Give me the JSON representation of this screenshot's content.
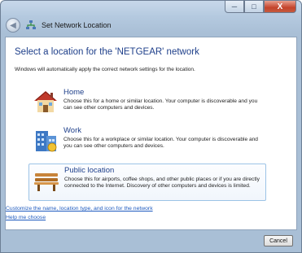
{
  "window": {
    "title": "Set Network Location",
    "minimize_glyph": "─",
    "maximize_glyph": "□",
    "close_glyph": "X",
    "back_glyph": "◀"
  },
  "main": {
    "heading": "Select a location for the 'NETGEAR' network",
    "subtext": "Windows will automatically apply the correct network settings for the location.",
    "options": [
      {
        "title": "Home",
        "description": "Choose this for a home or similar location. Your computer is discoverable and you can see other computers and devices.",
        "icon": "house-icon"
      },
      {
        "title": "Work",
        "description": "Choose this for a workplace or similar location. Your computer is discoverable and you can see other computers and devices.",
        "icon": "office-building-icon"
      },
      {
        "title": "Public location",
        "description": "Choose this for airports, coffee shops, and other public places or if you are directly connected to the Internet. Discovery of other computers and devices is limited.",
        "icon": "park-bench-icon"
      }
    ],
    "links": {
      "customize": "Customize the name, location type, and icon for the network",
      "help": "Help me choose"
    }
  },
  "footer": {
    "cancel_label": "Cancel"
  },
  "colors": {
    "heading": "#1e3f8a",
    "link": "#1f5bbf",
    "close_button": "#c4432b"
  }
}
